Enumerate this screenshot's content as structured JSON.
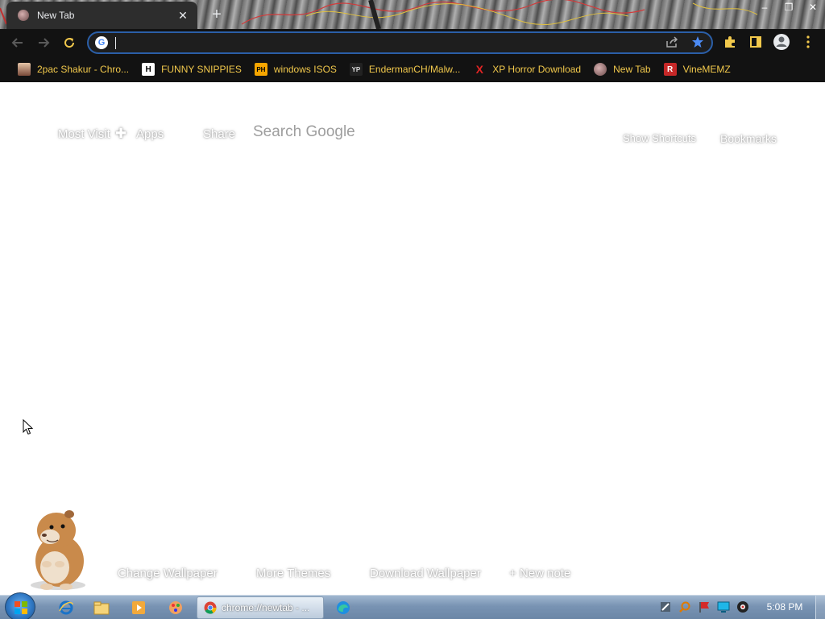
{
  "browser": {
    "tab_title": "New Tab",
    "tab_close_glyph": "✕",
    "new_tab_glyph": "+",
    "window_controls": [
      "–",
      "❐",
      "✕"
    ],
    "omnibox": {
      "value": "",
      "placeholder": ""
    }
  },
  "bookmarks": [
    {
      "label": "2pac Shakur - Chro...",
      "icon": "profile-photo-icon"
    },
    {
      "label": "FUNNY SNIPPIES",
      "icon": "h-logo-icon",
      "icon_text": "H"
    },
    {
      "label": "windows ISOS",
      "icon": "ph-logo-icon",
      "icon_text": "PH"
    },
    {
      "label": "EndermanCH/Malw...",
      "icon": "yp-logo-icon",
      "icon_text": "YP"
    },
    {
      "label": "XP Horror Download",
      "icon": "x-logo-icon",
      "icon_text": "X"
    },
    {
      "label": "New Tab",
      "icon": "new-tab-favicon-icon"
    },
    {
      "label": "VineMEMZ",
      "icon": "r-logo-icon",
      "icon_text": "R"
    }
  ],
  "ntp": {
    "most_visited": "Most Visit",
    "apps": "Apps",
    "share": "Share",
    "search_google": "Search Google",
    "show_shortcuts": "Show Shortcuts",
    "bookmarks": "Bookmarks",
    "change_wallpaper": "Change Wallpaper",
    "more_themes": "More Themes",
    "download_wallpaper": "Download Wallpaper",
    "new_note": "New note"
  },
  "taskbar": {
    "chrome_label": "chrome://newtab - ...",
    "clock": "5:08 PM"
  },
  "colors": {
    "bookmark_text": "#f2c94c",
    "toolbar_bg": "#121212",
    "omnibox_border": "#2b5fa8",
    "star_blue": "#4c8bf5",
    "taskbar": "#7893b3"
  }
}
